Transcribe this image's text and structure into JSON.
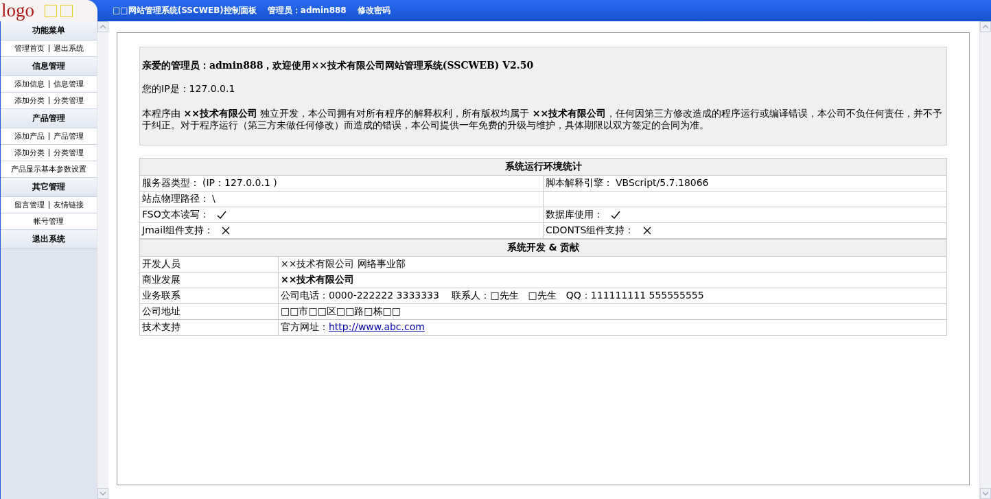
{
  "header": {
    "logo": "logo",
    "title": "□□网站管理系统(SSCWEB)控制面板",
    "admin": "管理员：admin888",
    "change_password": "修改密码"
  },
  "sidebar": {
    "sections": [
      {
        "title": "功能菜单",
        "items": [
          [
            "管理首页",
            "退出系统"
          ]
        ]
      },
      {
        "title": "信息管理",
        "items": [
          [
            "添加信息",
            "信息管理"
          ],
          [
            "添加分类",
            "分类管理"
          ]
        ]
      },
      {
        "title": "产品管理",
        "items": [
          [
            "添加产品",
            "产品管理"
          ],
          [
            "添加分类",
            "分类管理"
          ],
          [
            "产品显示基本参数设置"
          ]
        ]
      },
      {
        "title": "其它管理",
        "items": [
          [
            "留言管理",
            "友情链接"
          ],
          [
            "帐号管理"
          ]
        ]
      },
      {
        "title": "退出系统"
      }
    ]
  },
  "welcome": {
    "heading": "亲爱的管理员：admin888，欢迎使用××技术有限公司网站管理系统(SSCWEB) V2.50",
    "ip": "您的IP是：127.0.0.1",
    "notice": "本程序由 **××技术有限公司** 独立开发，本公司拥有对所有程序的解释权利，所有版权均属于 **××技术有限公司**，任何因第三方修改造成的程序运行或编译错误，本公司不负任何责任，并不予于纠正。对于程序运行（第三方未做任何修改）而造成的错误，本公司提供一年免费的升级与维护，具体期限以双方签定的合同为准。"
  },
  "environment": {
    "title": "系统运行环境统计",
    "rows": [
      {
        "cells": [
          {
            "label": "服务器类型：",
            "value": "(IP：127.0.0.1 )"
          },
          {
            "label": "脚本解释引擎：",
            "value": "VBScript/5.7.18066"
          }
        ]
      },
      {
        "cells": [
          {
            "label": "站点物理路径：",
            "value": "\\"
          }
        ]
      },
      {
        "cells": [
          {
            "label": "FSO文本读写：",
            "supported": true
          },
          {
            "label": "数据库使用：",
            "supported": true
          }
        ]
      },
      {
        "cells": [
          {
            "label": "Jmail组件支持：",
            "supported": false
          },
          {
            "label": "CDONTS组件支持：",
            "supported": false
          }
        ]
      }
    ]
  },
  "credits": {
    "title": "系统开发 & 贡献",
    "rows": [
      {
        "label": "开发人员",
        "kind": "text",
        "value": "××技术有限公司 网络事业部"
      },
      {
        "label": "商业发展",
        "kind": "bold",
        "value": "××技术有限公司"
      },
      {
        "label": "业务联系",
        "kind": "text",
        "value": "公司电话：0000-222222 3333333　 联系人：□先生　□先生　QQ：111111111 555555555"
      },
      {
        "label": "公司地址",
        "kind": "text",
        "value": "□□市□□区□□路□栋□□"
      },
      {
        "label": "技术支持",
        "kind": "link",
        "value": "官方网址：",
        "link": "http://www.abc.com"
      }
    ]
  }
}
